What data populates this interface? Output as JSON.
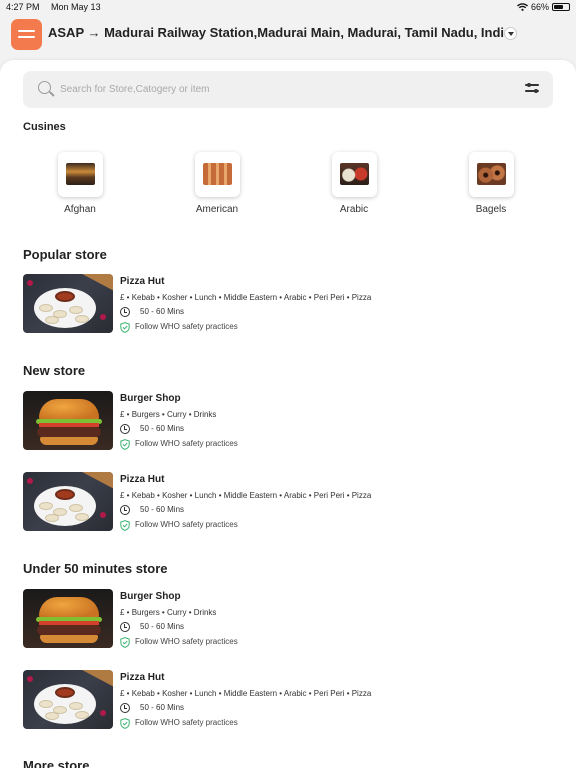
{
  "status_bar": {
    "time": "4:27 PM",
    "date": "Mon May 13",
    "battery": "66%",
    "battery_level": 0.66
  },
  "header": {
    "title": "ASAP → Madurai Railway Station,Madurai Main, Madurai, Tamil Nadu, India"
  },
  "search": {
    "placeholder": "Search for Store,Catogery or item",
    "value": ""
  },
  "cuisines": {
    "title": "Cusines",
    "items": [
      {
        "label": "Afghan"
      },
      {
        "label": "American"
      },
      {
        "label": "Arabic"
      },
      {
        "label": "Bagels"
      }
    ]
  },
  "popular": {
    "title": "Popular store",
    "stores": [
      {
        "name": "Pizza Hut",
        "tags": "£ • Kebab • Kosher • Lunch • Middle Eastern • Arabic • Peri Peri • Pizza",
        "time": "50 - 60 Mins",
        "safety": "Follow WHO safety practices",
        "image": "pizza"
      }
    ]
  },
  "new": {
    "title": "New store",
    "stores": [
      {
        "name": "Burger Shop",
        "tags": "£ • Burgers • Curry • Drinks",
        "time": "50 - 60 Mins",
        "safety": "Follow WHO safety practices",
        "image": "burger"
      },
      {
        "name": "Pizza Hut",
        "tags": "£ • Kebab • Kosher • Lunch • Middle Eastern • Arabic • Peri Peri • Pizza",
        "time": "50 - 60 Mins",
        "safety": "Follow WHO safety practices",
        "image": "pizza"
      }
    ]
  },
  "under50": {
    "title": "Under 50 minutes store",
    "stores": [
      {
        "name": "Burger Shop",
        "tags": "£ • Burgers • Curry • Drinks",
        "time": "50 - 60 Mins",
        "safety": "Follow WHO safety practices",
        "image": "burger"
      },
      {
        "name": "Pizza Hut",
        "tags": "£ • Kebab • Kosher • Lunch • Middle Eastern • Arabic • Peri Peri • Pizza",
        "time": "50 - 60 Mins",
        "safety": "Follow WHO safety practices",
        "image": "pizza"
      }
    ]
  },
  "more": {
    "title": "More store"
  },
  "colors": {
    "accent": "#f37a4c",
    "safety_green": "#3cb371"
  }
}
